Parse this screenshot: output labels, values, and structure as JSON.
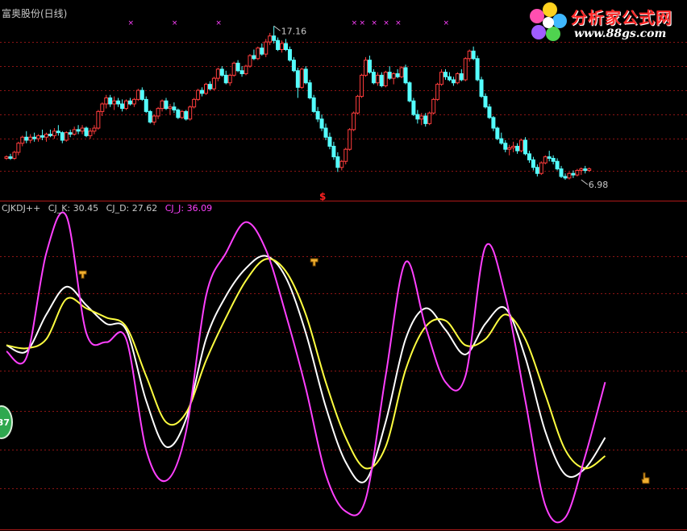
{
  "window": {
    "title": "富奥股份(日线)"
  },
  "logo": {
    "text": "分析家公式网",
    "url": "www.88gs.com",
    "icon": "flower-icon"
  },
  "badge": {
    "text": "37"
  },
  "indicator": {
    "name": "CJKDJ++",
    "k_label": "CJ_K: 30.45",
    "d_label": "CJ_D: 27.62",
    "j_label": "CJ_J: 36.09"
  },
  "colors": {
    "up": "#ff3c3c",
    "down": "#54ffff",
    "k": "#ffffff",
    "d": "#ffff40",
    "j": "#ff40ff",
    "grid": "#8c1414",
    "title": "#c8c8c8",
    "marker": "#ff40ff",
    "signal": "#ff2020"
  },
  "chart_data": [
    {
      "type": "candlestick",
      "title": "富奥股份(日线)",
      "ylim": [
        6.4,
        17.6
      ],
      "annotations": [
        {
          "label": "17.16",
          "day": 67,
          "value": 17.16
        },
        {
          "label": "6.98",
          "day": 144,
          "value": 6.98
        }
      ],
      "top_markers": [
        31,
        42,
        53,
        87,
        89,
        92,
        95,
        98,
        110
      ],
      "signal": {
        "label": "$",
        "day": 79
      },
      "candles": [
        [
          8.4,
          8.6,
          8.3,
          8.5
        ],
        [
          8.5,
          8.7,
          8.3,
          8.4
        ],
        [
          8.4,
          8.9,
          8.3,
          8.8
        ],
        [
          8.8,
          9.5,
          8.6,
          9.4
        ],
        [
          9.4,
          9.9,
          9.2,
          9.8
        ],
        [
          9.8,
          10.2,
          9.4,
          9.6
        ],
        [
          9.6,
          10.0,
          9.4,
          9.8
        ],
        [
          9.8,
          10.1,
          9.5,
          9.7
        ],
        [
          9.7,
          10.0,
          9.5,
          9.9
        ],
        [
          9.9,
          10.3,
          9.6,
          9.8
        ],
        [
          9.8,
          10.1,
          9.5,
          10.0
        ],
        [
          10.0,
          10.3,
          9.8,
          9.9
        ],
        [
          9.9,
          10.4,
          9.7,
          10.2
        ],
        [
          10.2,
          10.6,
          9.9,
          10.1
        ],
        [
          10.1,
          10.2,
          9.4,
          9.6
        ],
        [
          9.6,
          10.2,
          9.5,
          10.1
        ],
        [
          10.1,
          10.3,
          9.8,
          10.0
        ],
        [
          10.0,
          10.5,
          9.9,
          10.3
        ],
        [
          10.3,
          10.6,
          10.0,
          10.2
        ],
        [
          10.2,
          10.6,
          10.0,
          10.4
        ],
        [
          10.4,
          10.5,
          9.8,
          9.9
        ],
        [
          9.9,
          10.4,
          9.7,
          10.2
        ],
        [
          10.2,
          10.6,
          10.0,
          10.4
        ],
        [
          10.4,
          11.6,
          10.3,
          11.5
        ],
        [
          11.5,
          12.1,
          11.2,
          12.0
        ],
        [
          12.0,
          12.6,
          11.7,
          12.4
        ],
        [
          12.4,
          12.6,
          11.8,
          12.0
        ],
        [
          12.0,
          12.5,
          11.6,
          12.2
        ],
        [
          12.2,
          12.4,
          11.8,
          12.0
        ],
        [
          12.0,
          12.3,
          11.5,
          11.7
        ],
        [
          11.7,
          12.3,
          11.6,
          12.2
        ],
        [
          12.2,
          12.4,
          11.9,
          12.0
        ],
        [
          12.0,
          12.4,
          11.8,
          12.3
        ],
        [
          12.3,
          13.0,
          12.2,
          12.9
        ],
        [
          12.9,
          13.1,
          12.2,
          12.3
        ],
        [
          12.3,
          12.5,
          11.4,
          11.5
        ],
        [
          11.5,
          11.6,
          10.7,
          10.8
        ],
        [
          10.8,
          11.3,
          10.6,
          11.2
        ],
        [
          11.2,
          11.8,
          11.0,
          11.7
        ],
        [
          11.7,
          12.3,
          11.5,
          12.2
        ],
        [
          12.2,
          12.4,
          11.6,
          11.7
        ],
        [
          11.7,
          12.0,
          11.3,
          11.8
        ],
        [
          11.8,
          12.1,
          11.4,
          11.6
        ],
        [
          11.6,
          11.7,
          11.0,
          11.1
        ],
        [
          11.1,
          11.6,
          11.0,
          11.5
        ],
        [
          11.5,
          11.6,
          10.9,
          11.0
        ],
        [
          11.0,
          11.9,
          10.9,
          11.8
        ],
        [
          11.8,
          12.4,
          11.7,
          12.3
        ],
        [
          12.3,
          13.0,
          12.2,
          12.9
        ],
        [
          12.9,
          13.1,
          12.5,
          12.7
        ],
        [
          12.7,
          13.4,
          12.6,
          13.3
        ],
        [
          13.3,
          13.5,
          12.9,
          13.0
        ],
        [
          13.0,
          13.8,
          12.9,
          13.7
        ],
        [
          13.7,
          14.4,
          13.5,
          14.3
        ],
        [
          14.3,
          14.5,
          13.8,
          13.9
        ],
        [
          13.9,
          14.2,
          13.3,
          13.4
        ],
        [
          13.4,
          14.0,
          13.2,
          13.9
        ],
        [
          13.9,
          14.8,
          13.8,
          14.7
        ],
        [
          14.7,
          14.9,
          14.1,
          14.2
        ],
        [
          14.2,
          14.5,
          13.8,
          14.0
        ],
        [
          14.0,
          14.6,
          13.9,
          14.5
        ],
        [
          14.5,
          15.3,
          14.4,
          15.2
        ],
        [
          15.2,
          15.6,
          14.9,
          15.0
        ],
        [
          15.0,
          15.8,
          14.9,
          15.7
        ],
        [
          15.7,
          16.0,
          15.2,
          15.3
        ],
        [
          15.3,
          16.3,
          15.1,
          16.1
        ],
        [
          16.1,
          16.7,
          15.9,
          16.5
        ],
        [
          16.5,
          17.16,
          16.0,
          16.2
        ],
        [
          16.2,
          16.4,
          15.5,
          15.6
        ],
        [
          15.6,
          16.2,
          15.4,
          16.0
        ],
        [
          16.0,
          16.3,
          15.5,
          15.6
        ],
        [
          15.6,
          15.8,
          14.8,
          14.9
        ],
        [
          14.9,
          15.1,
          14.1,
          14.2
        ],
        [
          14.2,
          14.4,
          12.4,
          13.1
        ],
        [
          13.1,
          14.4,
          13.0,
          14.3
        ],
        [
          14.3,
          14.5,
          13.3,
          13.4
        ],
        [
          13.4,
          13.6,
          12.3,
          12.4
        ],
        [
          12.4,
          12.6,
          11.4,
          11.5
        ],
        [
          11.5,
          11.8,
          10.8,
          11.0
        ],
        [
          11.0,
          11.3,
          10.2,
          10.4
        ],
        [
          10.4,
          10.7,
          9.6,
          9.8
        ],
        [
          9.8,
          10.1,
          9.0,
          9.2
        ],
        [
          9.2,
          9.5,
          8.3,
          8.5
        ],
        [
          8.5,
          8.8,
          7.5,
          7.8
        ],
        [
          7.8,
          8.3,
          7.6,
          8.2
        ],
        [
          8.2,
          9.1,
          8.0,
          9.0
        ],
        [
          9.0,
          10.4,
          8.9,
          10.3
        ],
        [
          10.3,
          11.5,
          10.2,
          11.4
        ],
        [
          11.4,
          12.6,
          11.3,
          12.5
        ],
        [
          12.5,
          14.0,
          12.4,
          13.9
        ],
        [
          13.9,
          15.1,
          13.8,
          14.9
        ],
        [
          14.9,
          15.2,
          14.0,
          14.1
        ],
        [
          14.1,
          14.3,
          13.3,
          13.4
        ],
        [
          13.4,
          14.1,
          13.2,
          13.9
        ],
        [
          13.9,
          14.1,
          13.1,
          13.2
        ],
        [
          13.2,
          14.2,
          13.1,
          14.1
        ],
        [
          14.1,
          14.5,
          13.6,
          13.7
        ],
        [
          13.7,
          14.1,
          13.3,
          14.0
        ],
        [
          14.0,
          14.3,
          13.7,
          13.8
        ],
        [
          13.8,
          14.5,
          13.7,
          14.4
        ],
        [
          14.4,
          14.6,
          13.3,
          13.4
        ],
        [
          13.4,
          13.5,
          12.1,
          12.2
        ],
        [
          12.2,
          12.4,
          11.2,
          11.3
        ],
        [
          11.3,
          11.6,
          10.7,
          11.0
        ],
        [
          11.0,
          11.4,
          10.6,
          11.2
        ],
        [
          11.2,
          11.4,
          10.5,
          10.7
        ],
        [
          10.7,
          11.5,
          10.6,
          11.4
        ],
        [
          11.4,
          12.4,
          11.3,
          12.3
        ],
        [
          12.3,
          13.4,
          12.2,
          13.3
        ],
        [
          13.3,
          14.3,
          13.2,
          14.1
        ],
        [
          14.1,
          14.3,
          13.6,
          13.8
        ],
        [
          13.8,
          14.1,
          13.5,
          13.6
        ],
        [
          13.6,
          13.8,
          13.2,
          13.4
        ],
        [
          13.4,
          14.1,
          13.3,
          14.0
        ],
        [
          14.0,
          14.3,
          13.5,
          13.6
        ],
        [
          13.6,
          15.1,
          13.5,
          15.0
        ],
        [
          15.0,
          15.6,
          14.8,
          15.5
        ],
        [
          15.5,
          15.8,
          14.9,
          15.0
        ],
        [
          15.0,
          15.2,
          13.5,
          13.6
        ],
        [
          13.6,
          13.8,
          12.4,
          12.5
        ],
        [
          12.5,
          12.7,
          11.7,
          11.8
        ],
        [
          11.8,
          12.0,
          11.0,
          11.1
        ],
        [
          11.1,
          11.2,
          10.2,
          10.4
        ],
        [
          10.4,
          10.5,
          9.6,
          9.7
        ],
        [
          9.7,
          10.1,
          9.3,
          9.4
        ],
        [
          9.4,
          9.6,
          8.8,
          9.0
        ],
        [
          9.0,
          9.3,
          8.6,
          9.1
        ],
        [
          9.1,
          9.5,
          8.8,
          9.2
        ],
        [
          9.2,
          9.4,
          8.7,
          8.9
        ],
        [
          8.9,
          9.7,
          8.8,
          9.6
        ],
        [
          9.6,
          9.8,
          8.6,
          8.7
        ],
        [
          8.7,
          8.9,
          8.1,
          8.3
        ],
        [
          8.3,
          8.5,
          7.6,
          7.8
        ],
        [
          7.8,
          8.0,
          7.2,
          7.4
        ],
        [
          7.4,
          8.2,
          7.3,
          8.1
        ],
        [
          8.1,
          8.6,
          8.0,
          8.5
        ],
        [
          8.5,
          8.9,
          8.2,
          8.4
        ],
        [
          8.4,
          8.6,
          8.0,
          8.2
        ],
        [
          8.2,
          8.4,
          7.6,
          7.7
        ],
        [
          7.7,
          7.9,
          7.1,
          7.2
        ],
        [
          7.2,
          7.4,
          6.98,
          7.1
        ],
        [
          7.1,
          7.5,
          7.0,
          7.4
        ],
        [
          7.4,
          7.6,
          7.1,
          7.3
        ],
        [
          7.3,
          7.7,
          7.2,
          7.6
        ],
        [
          7.6,
          7.8,
          7.3,
          7.7
        ],
        [
          7.7,
          7.9,
          7.4,
          7.6
        ],
        [
          7.6,
          7.8,
          7.5,
          7.7
        ]
      ]
    },
    {
      "type": "line",
      "title": "CJKDJ++",
      "ylim": [
        0,
        100
      ],
      "x": [
        0,
        5,
        10,
        15,
        20,
        25,
        30,
        35,
        40,
        45,
        50,
        55,
        60,
        65,
        70,
        75,
        80,
        85,
        90,
        95,
        100,
        105,
        110,
        115,
        120,
        125,
        130,
        135,
        140,
        145,
        150
      ],
      "series": [
        {
          "name": "CJ_K",
          "color": "#ffffff",
          "values": [
            58,
            56,
            68,
            77,
            71,
            65,
            63,
            40,
            25,
            34,
            60,
            74,
            83,
            87,
            80,
            62,
            38,
            20,
            14,
            33,
            60,
            70,
            63,
            55,
            65,
            70,
            54,
            30,
            16,
            18,
            28
          ]
        },
        {
          "name": "CJ_D",
          "color": "#ffff40",
          "values": [
            58,
            57,
            60,
            73,
            70,
            67,
            64,
            48,
            33,
            36,
            53,
            67,
            79,
            86,
            82,
            68,
            46,
            28,
            18,
            25,
            50,
            64,
            66,
            58,
            60,
            68,
            60,
            42,
            24,
            18,
            22
          ]
        },
        {
          "name": "CJ_J",
          "color": "#ff40ff",
          "values": [
            56,
            54,
            88,
            100,
            62,
            59,
            60,
            24,
            14,
            30,
            74,
            88,
            98,
            89,
            68,
            44,
            16,
            4,
            8,
            48,
            85,
            64,
            46,
            48,
            90,
            74,
            40,
            6,
            2,
            22,
            46
          ]
        }
      ],
      "markers": [
        {
          "day": 19,
          "value": 79,
          "label": "cross-up-marker"
        },
        {
          "day": 77,
          "value": 83,
          "label": "cross-up-marker"
        },
        {
          "day": 160,
          "value": 16,
          "label": "hand-pointer-marker"
        }
      ]
    }
  ]
}
